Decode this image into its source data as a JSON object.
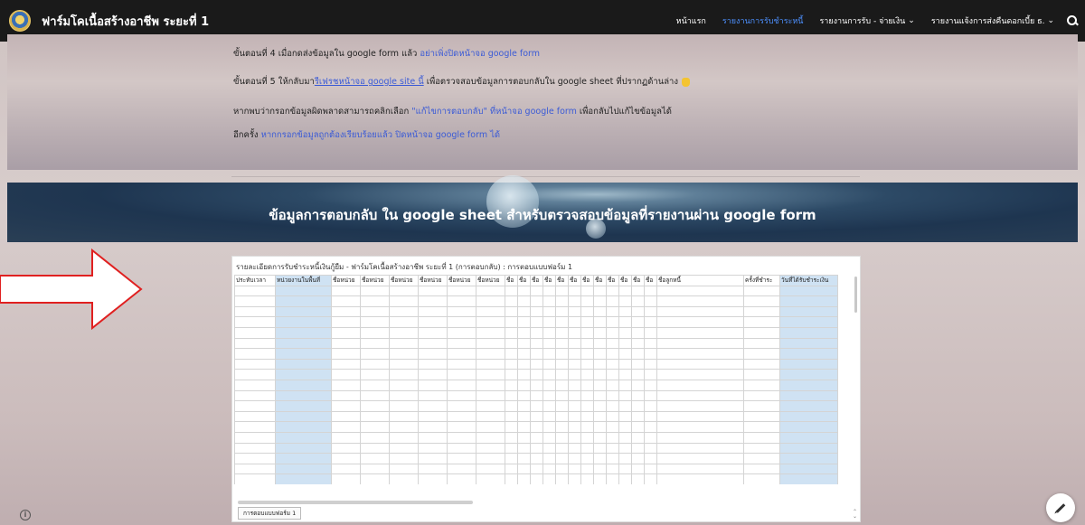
{
  "site": {
    "title": "ฟาร์มโคเนื้อสร้างอาชีพ ระยะที่ 1"
  },
  "nav": {
    "items": [
      {
        "label": "หน้าแรก",
        "active": false,
        "has_dropdown": false
      },
      {
        "label": "รายงานการรับชำระหนี้",
        "active": true,
        "has_dropdown": false
      },
      {
        "label": "รายงานการรับ - จ่ายเงิน",
        "active": false,
        "has_dropdown": true
      },
      {
        "label": "รายงานแจ้งการส่งคืนดอกเบี้ย ธ.",
        "active": false,
        "has_dropdown": true
      }
    ],
    "active_color": "#4d90fe"
  },
  "instructions": {
    "step4": {
      "text": "ขั้นตอนที่ 4  เมื่อกดส่งข้อมูลใน google form แล้ว ",
      "link": "อย่าเพิ่งปิดหน้าจอ google form"
    },
    "step5": {
      "text_a": "ขั้นตอนที่ 5  ให้กลับมา",
      "link": "รีเฟรชหน้าจอ google site นี้",
      "text_b": " เพื่อตรวจสอบข้อมูลการตอบกลับใน google sheet ที่ปรากฏด้านล่าง"
    },
    "line3": {
      "text_a": "หากพบว่ากรอกข้อมูลผิดพลาดสามารถคลิกเลือก ",
      "link": "\"แก้ไขการตอบกลับ\" ที่หน้าจอ google form",
      "text_b": " เพื่อกลับไปแก้ไขข้อมูลได้"
    },
    "line4": {
      "text_a": "อีกครั้ง  ",
      "link": "หากกรอกข้อมูลถูกต้องเรียบร้อยแล้ว ปิดหน้าจอ google form ได้"
    },
    "link_color": "#3b5bd6"
  },
  "banner": {
    "title": "ข้อมูลการตอบกลับ ใน google sheet สำหรับตรวจสอบข้อมูลที่รายงานผ่าน google form"
  },
  "sheet": {
    "title": "รายละเอียดการรับชำระหนี้เงินกู้ยืม - ฟาร์มโคเนื้อสร้างอาชีพ ระยะที่ 1 (การตอบกลับ) : การตอบแบบฟอร์ม 1",
    "headers": [
      "ประทับเวลา",
      "หน่วยงานในพื้นที่",
      "ชื่อหน่วย",
      "ชื่อหน่วย",
      "ชื่อหน่วย",
      "ชื่อหน่วย",
      "ชื่อหน่วย",
      "ชื่อหน่วย",
      "ชื่อ",
      "ชื่อ",
      "ชื่อ",
      "ชื่อ",
      "ชื่อ",
      "ชื่อ",
      "ชื่อ",
      "ชื่อ",
      "ชื่อ",
      "ชื่อ",
      "ชื่อ",
      "ชื่อ",
      "ชื่อลูกหนี้",
      "ครั้งที่ชำระ",
      "วันที่ได้รับชำระเงิน"
    ],
    "highlight_color": "#cfe2f3",
    "tab_label": "การตอบแบบฟอร์ม 1"
  },
  "icons": {
    "logo": "organization-logo",
    "search": "search-icon",
    "info": "info-icon",
    "edit": "pencil-icon",
    "pointer": "pointing-hand-icon",
    "arrow": "right-arrow-outline"
  }
}
